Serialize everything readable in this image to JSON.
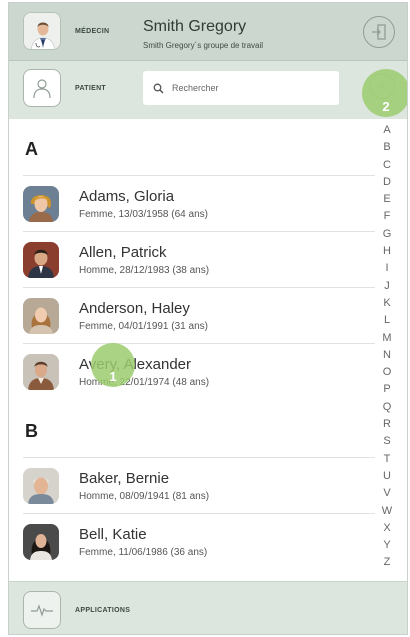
{
  "header": {
    "role": "MÉDECIN",
    "doctor_name": "Smith Gregory",
    "group": "Smith Gregory´s groupe de travail"
  },
  "patient_bar": {
    "label": "PATIENT",
    "search_placeholder": "Rechercher"
  },
  "sections": [
    {
      "letter": "A",
      "patients": [
        {
          "name": "Adams, Gloria",
          "meta": "Femme, 13/03/1958 (64 ans)"
        },
        {
          "name": "Allen, Patrick",
          "meta": "Homme, 28/12/1983 (38 ans)"
        },
        {
          "name": "Anderson, Haley",
          "meta": "Femme, 04/01/1991 (31 ans)"
        },
        {
          "name": "Avery, Alexander",
          "meta": "Homme, 22/01/1974 (48 ans)"
        }
      ]
    },
    {
      "letter": "B",
      "patients": [
        {
          "name": "Baker, Bernie",
          "meta": "Homme, 08/09/1941 (81 ans)"
        },
        {
          "name": "Bell, Katie",
          "meta": "Femme, 11/06/1986 (36 ans)"
        }
      ]
    }
  ],
  "alphabet": [
    "A",
    "B",
    "C",
    "D",
    "E",
    "F",
    "G",
    "H",
    "I",
    "J",
    "K",
    "L",
    "M",
    "N",
    "O",
    "P",
    "Q",
    "R",
    "S",
    "T",
    "U",
    "V",
    "W",
    "X",
    "Y",
    "Z"
  ],
  "bottom": {
    "label": "APPLICATIONS"
  },
  "touch_markers": [
    "1",
    "2"
  ],
  "colors": {
    "header_bg": "#ccd8cf",
    "bar_bg": "#dde5df",
    "touch": "#9bcd6e"
  }
}
